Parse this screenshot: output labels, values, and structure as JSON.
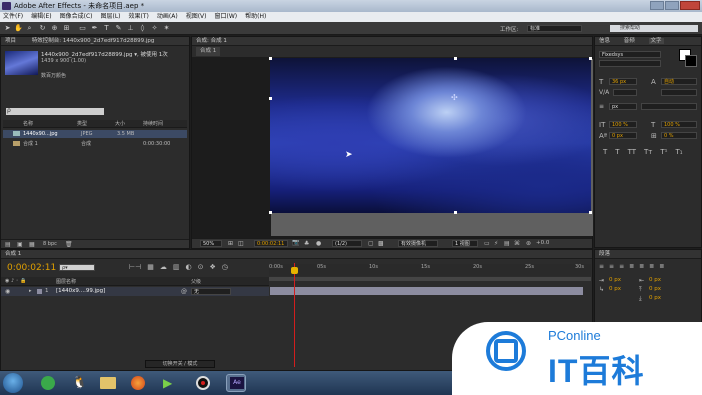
{
  "window": {
    "title": "Adobe After Effects - 未命名项目.aep *"
  },
  "menu": [
    "文件(F)",
    "编辑(E)",
    "图像合成(C)",
    "图层(L)",
    "效果(T)",
    "动画(A)",
    "视图(V)",
    "窗口(W)",
    "帮助(H)"
  ],
  "toolbar": {
    "workspace_label": "工作区:",
    "workspace_value": "标准",
    "search_placeholder": "搜索帮助"
  },
  "project": {
    "tab_label": "项目",
    "effects_tab": "特效控制台: 1440x900_2d7edf917d28899.jpg",
    "file_name": "1440x900_2d7edf917d28899.jpg ▾, 被使用 1次",
    "file_dims": "1439 x 900 (1.00)",
    "file_color": "数百万颜色",
    "columns": [
      "名称",
      "类型",
      "大小",
      "持续时间"
    ],
    "rows": [
      {
        "name": "1440x90...jpg",
        "type": "JPEG",
        "size": "3.5 MB",
        "duration": ""
      },
      {
        "name": "合成 1",
        "type": "合成",
        "size": "",
        "duration": "0:00:30:00"
      }
    ],
    "bpc": "8 bpc"
  },
  "composition": {
    "tab_label": "合成: 合成 1",
    "sub_tab": "合成 1",
    "zoom": "50%",
    "timecode": "0:00:02:11",
    "resolution": "(1/2)",
    "camera": "有效摄像机",
    "views": "1 视图",
    "exposure": "+0.0"
  },
  "info_panel": {
    "tabs": [
      "信息",
      "音频",
      "文字"
    ]
  },
  "character": {
    "font": "Fixedsys",
    "size": "36 px",
    "leading": "自动",
    "tracking_unit": "px",
    "vscale": "100 %",
    "hscale": "100 %",
    "baseline": "0 px",
    "tsume": "0 %"
  },
  "paragraph": {
    "tab_label": "段落",
    "indent_left": "0 px",
    "indent_right": "0 px",
    "indent_first": "0 px",
    "space_before": "0 px",
    "space_after": "0 px"
  },
  "timeline": {
    "tab_label": "合成 1",
    "timecode": "0:00:02:11",
    "search_placeholder": "ρ▾",
    "columns": [
      "图层名称",
      "父级"
    ],
    "ruler": [
      "0:00s",
      "05s",
      "10s",
      "15s",
      "20s",
      "25s",
      "30s"
    ],
    "layer": {
      "index": "1",
      "name": "[1440x9....99.jpg]",
      "parent": "无"
    },
    "bottom_label": "切换开关 / 模式"
  },
  "watermark": {
    "line1": "PConline",
    "line2": "IT百科"
  },
  "colors": {
    "accent_timecode": "#e0a000",
    "playhead": "#d21e1e",
    "watermark": "#1d7bd9"
  }
}
